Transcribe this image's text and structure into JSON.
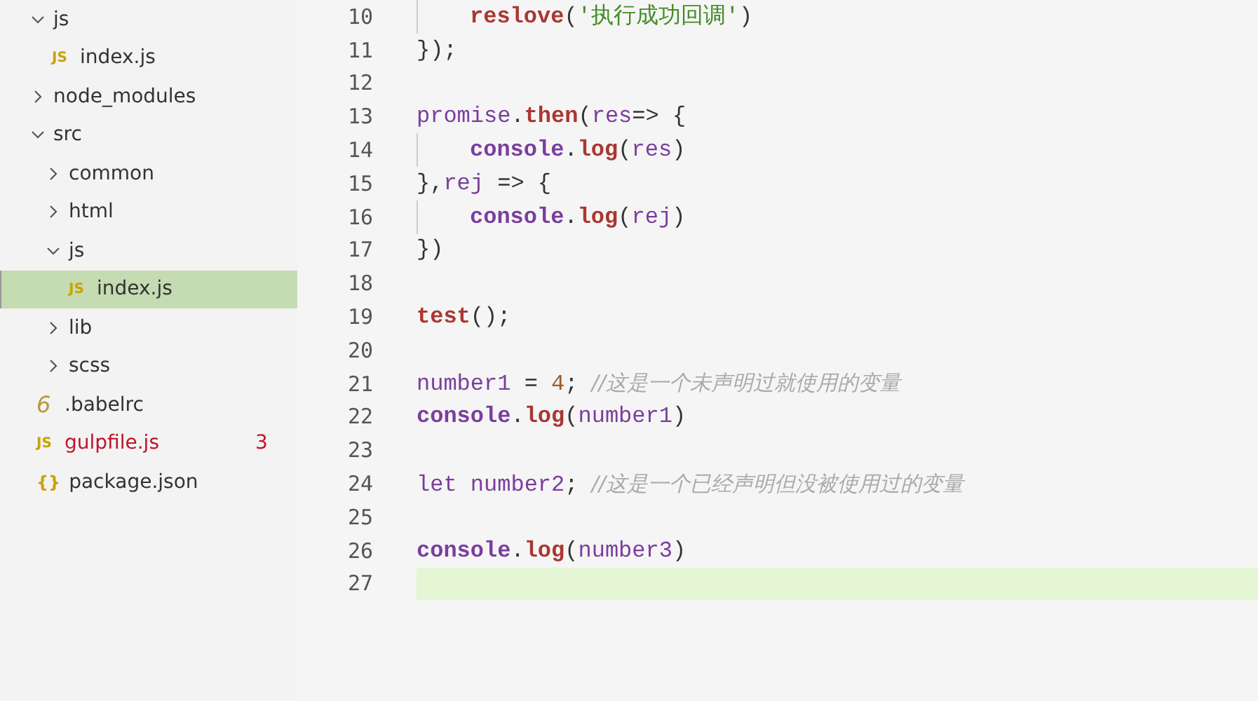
{
  "explorer": {
    "items": [
      {
        "kind": "folder",
        "label": "js",
        "expanded": true,
        "selected": false,
        "children": [
          {
            "kind": "file",
            "icon": "JS",
            "label": "index.js",
            "selected": false
          }
        ]
      },
      {
        "kind": "folder",
        "label": "node_modules",
        "expanded": false,
        "selected": false
      },
      {
        "kind": "folder",
        "label": "src",
        "expanded": true,
        "selected": false,
        "children": [
          {
            "kind": "folder",
            "label": "common",
            "expanded": false,
            "selected": false
          },
          {
            "kind": "folder",
            "label": "html",
            "expanded": false,
            "selected": false
          },
          {
            "kind": "folder",
            "label": "js",
            "expanded": true,
            "selected": false,
            "children": [
              {
                "kind": "file",
                "icon": "JS",
                "label": "index.js",
                "selected": true
              }
            ]
          },
          {
            "kind": "folder",
            "label": "lib",
            "expanded": false,
            "selected": false
          },
          {
            "kind": "folder",
            "label": "scss",
            "expanded": false,
            "selected": false
          }
        ]
      },
      {
        "kind": "file",
        "icon": "6",
        "label": ".babelrc",
        "selected": false
      },
      {
        "kind": "file",
        "icon": "JS",
        "label": "gulpfile.js",
        "selected": false,
        "has_errors": true,
        "problems": "3"
      },
      {
        "kind": "file",
        "icon": "{}",
        "label": "package.json",
        "selected": false
      }
    ]
  },
  "editor": {
    "lines": [
      {
        "number": "10",
        "guide": true,
        "tokens": [
          {
            "kind": "fn",
            "text": "reslove"
          },
          {
            "kind": "punct",
            "text": "("
          },
          {
            "kind": "str",
            "text": "'执行成功回调'"
          },
          {
            "kind": "punct",
            "text": ")"
          }
        ]
      },
      {
        "number": "11",
        "tokens": [
          {
            "kind": "punct",
            "text": "});"
          }
        ]
      },
      {
        "number": "12"
      },
      {
        "number": "13",
        "tokens": [
          {
            "kind": "var",
            "text": "promise"
          },
          {
            "kind": "punct",
            "text": "."
          },
          {
            "kind": "fn",
            "text": "then"
          },
          {
            "kind": "punct",
            "text": "("
          },
          {
            "kind": "var",
            "text": "res"
          },
          {
            "kind": "punct",
            "text": "=> {"
          }
        ]
      },
      {
        "number": "14",
        "guide": true,
        "tokens": [
          {
            "kind": "obj",
            "text": "console"
          },
          {
            "kind": "punct",
            "text": "."
          },
          {
            "kind": "fn",
            "text": "log"
          },
          {
            "kind": "punct",
            "text": "("
          },
          {
            "kind": "var",
            "text": "res"
          },
          {
            "kind": "punct",
            "text": ")"
          }
        ]
      },
      {
        "number": "15",
        "tokens": [
          {
            "kind": "punct",
            "text": "},"
          },
          {
            "kind": "var",
            "text": "rej"
          },
          {
            "kind": "punct",
            "text": " => {"
          }
        ]
      },
      {
        "number": "16",
        "guide": true,
        "tokens": [
          {
            "kind": "obj",
            "text": "console"
          },
          {
            "kind": "punct",
            "text": "."
          },
          {
            "kind": "fn",
            "text": "log"
          },
          {
            "kind": "punct",
            "text": "("
          },
          {
            "kind": "var",
            "text": "rej"
          },
          {
            "kind": "punct",
            "text": ")"
          }
        ]
      },
      {
        "number": "17",
        "tokens": [
          {
            "kind": "punct",
            "text": "})"
          }
        ]
      },
      {
        "number": "18"
      },
      {
        "number": "19",
        "tokens": [
          {
            "kind": "fn",
            "text": "test"
          },
          {
            "kind": "punct",
            "text": "();"
          }
        ]
      },
      {
        "number": "20"
      },
      {
        "number": "21",
        "tokens": [
          {
            "kind": "var",
            "text": "number1"
          },
          {
            "kind": "punct",
            "text": " = "
          },
          {
            "kind": "num",
            "text": "4"
          },
          {
            "kind": "punct",
            "text": "; "
          },
          {
            "kind": "comment",
            "text": "//这是一个未声明过就使用的变量"
          }
        ]
      },
      {
        "number": "22",
        "tokens": [
          {
            "kind": "obj",
            "text": "console"
          },
          {
            "kind": "punct",
            "text": "."
          },
          {
            "kind": "fn",
            "text": "log"
          },
          {
            "kind": "punct",
            "text": "("
          },
          {
            "kind": "var",
            "text": "number1"
          },
          {
            "kind": "punct",
            "text": ")"
          }
        ]
      },
      {
        "number": "23"
      },
      {
        "number": "24",
        "tokens": [
          {
            "kind": "var",
            "text": "let number2"
          },
          {
            "kind": "punct",
            "text": "; "
          },
          {
            "kind": "comment",
            "text": "//这是一个已经声明但没被使用过的变量"
          }
        ]
      },
      {
        "number": "25"
      },
      {
        "number": "26",
        "tokens": [
          {
            "kind": "obj",
            "text": "console"
          },
          {
            "kind": "punct",
            "text": "."
          },
          {
            "kind": "fn",
            "text": "log"
          },
          {
            "kind": "punct",
            "text": "("
          },
          {
            "kind": "var",
            "text": "number3"
          },
          {
            "kind": "punct",
            "text": ")"
          }
        ]
      },
      {
        "number": "27",
        "current": true
      }
    ]
  }
}
